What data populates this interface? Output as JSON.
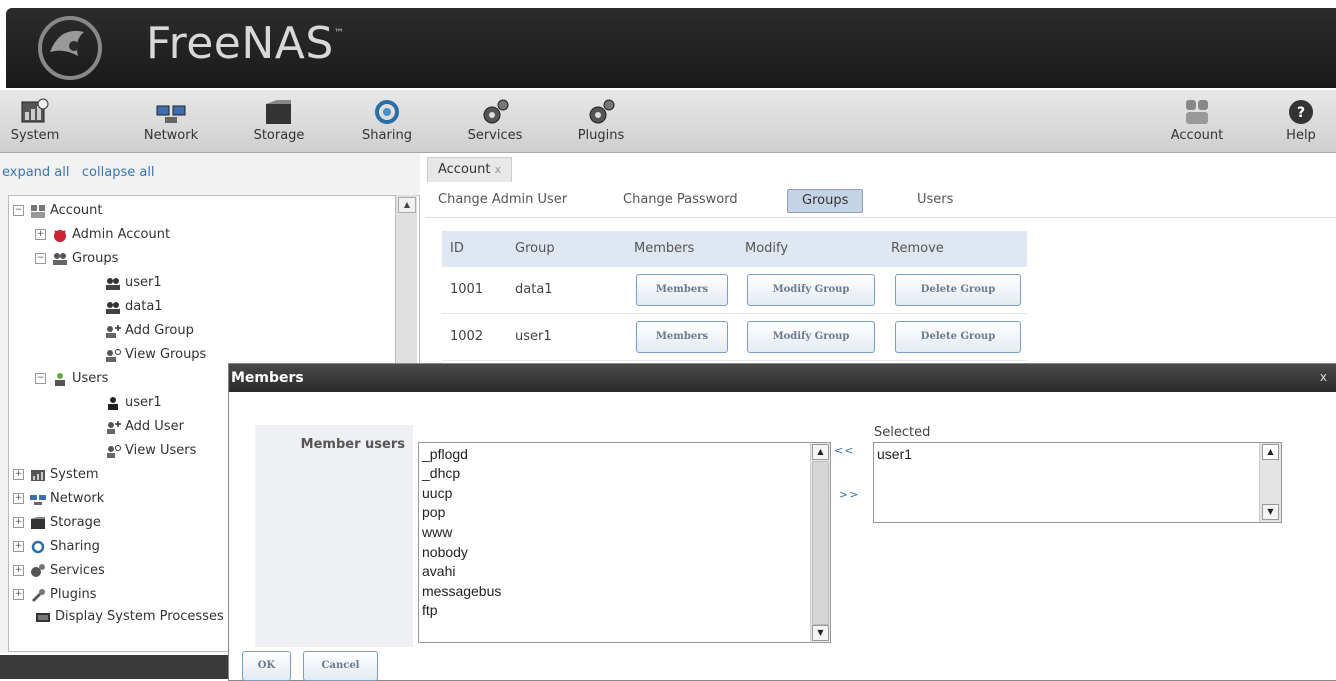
{
  "brand": {
    "name": "FreeNAS",
    "tm": "™"
  },
  "toolbar": {
    "items": [
      "System",
      "Network",
      "Storage",
      "Sharing",
      "Services",
      "Plugins"
    ],
    "right": [
      "Account",
      "Help"
    ]
  },
  "sidebar": {
    "expand_all": "expand all",
    "collapse_all": "collapse all",
    "tree": [
      {
        "label": "Account",
        "icon": "account-icon"
      },
      {
        "label": "Admin Account",
        "icon": "admin-icon"
      },
      {
        "label": "Groups",
        "icon": "groups-icon"
      },
      {
        "label": "user1",
        "icon": "group-icon"
      },
      {
        "label": "data1",
        "icon": "group-icon"
      },
      {
        "label": "Add Group",
        "icon": "add-group-icon"
      },
      {
        "label": "View Groups",
        "icon": "view-groups-icon"
      },
      {
        "label": "Users",
        "icon": "users-icon"
      },
      {
        "label": "user1",
        "icon": "user-icon"
      },
      {
        "label": "Add User",
        "icon": "add-user-icon"
      },
      {
        "label": "View Users",
        "icon": "view-users-icon"
      },
      {
        "label": "System",
        "icon": "system-icon"
      },
      {
        "label": "Network",
        "icon": "network-icon"
      },
      {
        "label": "Storage",
        "icon": "storage-icon"
      },
      {
        "label": "Sharing",
        "icon": "sharing-icon"
      },
      {
        "label": "Services",
        "icon": "services-icon"
      },
      {
        "label": "Plugins",
        "icon": "plugins-icon"
      },
      {
        "label": "Display System Processes",
        "icon": "processes-icon"
      }
    ]
  },
  "content": {
    "tab_label": "Account",
    "tab_close": "x",
    "subnav": [
      "Change Admin User",
      "Change Password",
      "Groups",
      "Users"
    ],
    "grid": {
      "columns": [
        "ID",
        "Group",
        "Members",
        "Modify",
        "Remove"
      ],
      "rows": [
        {
          "id": "1001",
          "group": "data1"
        },
        {
          "id": "1002",
          "group": "user1"
        }
      ],
      "members_label": "Members",
      "modify_label": "Modify Group",
      "delete_label": "Delete Group"
    }
  },
  "dialog": {
    "title": "Members",
    "close": "x",
    "field_label": "Member users",
    "available": [
      "_pflogd",
      "_dhcp",
      "uucp",
      "pop",
      "www",
      "nobody",
      "avahi",
      "messagebus",
      "ftp"
    ],
    "remove_arrow": "<<",
    "add_arrow": ">>",
    "selected_label": "Selected",
    "selected": [
      "user1"
    ],
    "ok": "OK",
    "cancel": "Cancel"
  }
}
